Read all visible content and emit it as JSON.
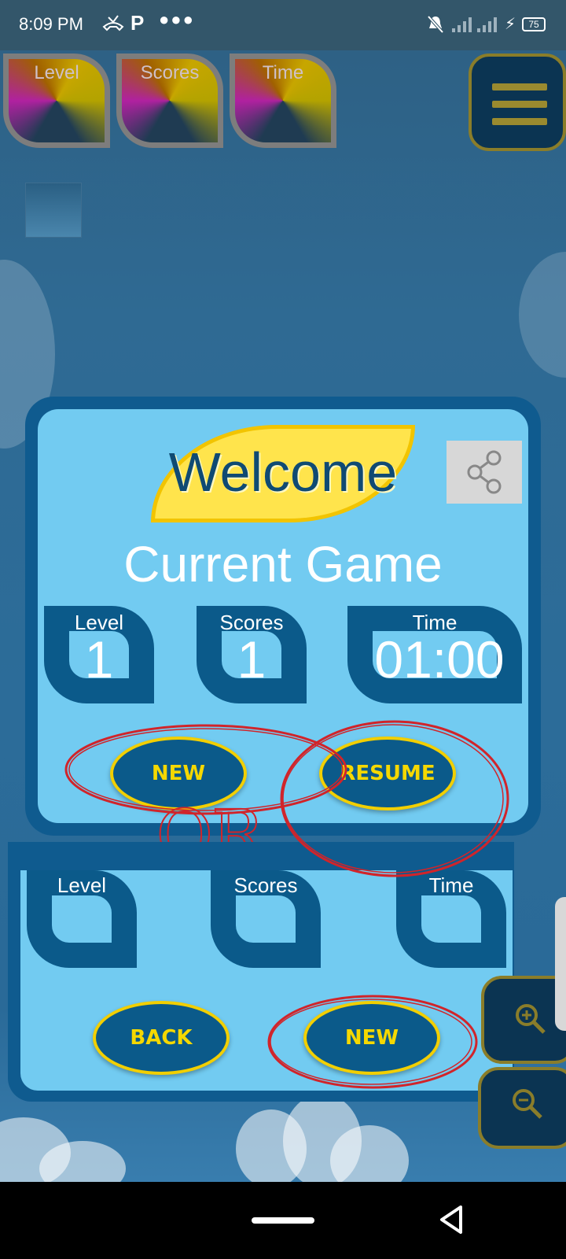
{
  "status_bar": {
    "time": "8:09 PM",
    "battery": "75",
    "icons": [
      "missed-call-icon",
      "parking-app-icon",
      "more-dots-icon",
      "mute-icon",
      "signal-icon",
      "signal-icon",
      "charging-icon",
      "battery-icon"
    ]
  },
  "hud": {
    "level_label": "Level",
    "scores_label": "Scores",
    "time_label": "Time",
    "menu_icon": "hamburger-menu-icon"
  },
  "welcome_dialog": {
    "title": "Welcome",
    "subtitle": "Current Game",
    "share_icon": "share-icon",
    "stats": {
      "level_label": "Level",
      "level_value": "1",
      "scores_label": "Scores",
      "scores_value": "1",
      "time_label": "Time",
      "time_value": "01:00"
    },
    "new_button": "NEW",
    "resume_button": "RESUME"
  },
  "divider_text": "OR",
  "second_dialog": {
    "stats": {
      "level_label": "Level",
      "scores_label": "Scores",
      "time_label": "Time"
    },
    "back_button": "BACK",
    "new_button": "NEW"
  },
  "zoom": {
    "zoom_in_icon": "zoom-in-icon",
    "zoom_out_icon": "zoom-out-icon"
  },
  "colors": {
    "dialog_border": "#0f5b8f",
    "dialog_fill": "#72cbf1",
    "button_fill": "#0b5a8a",
    "button_text": "#f5d800",
    "welcome_banner": "#ffe44c",
    "annotation_red": "#d1242a"
  }
}
